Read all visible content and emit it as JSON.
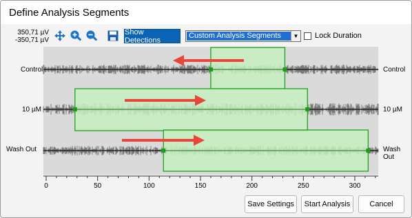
{
  "window": {
    "title": "Define Analysis Segments"
  },
  "toolbar": {
    "voltage_max": "350,71 µV",
    "voltage_min": "-350,71 µV",
    "show_detections_label": "Show Detections",
    "segments_select_value": "Custom Analysis Segments",
    "lock_duration_label": "Lock Duration",
    "lock_duration_checked": false,
    "icons": [
      "fit-axis-icon",
      "zoom-in-icon",
      "zoom-out-icon",
      "save-icon"
    ]
  },
  "channels": [
    {
      "label": "Control",
      "segment": [
        160,
        232
      ],
      "arrow": "left"
    },
    {
      "label": "10 µM",
      "segment": [
        28,
        254
      ],
      "arrow": "right"
    },
    {
      "label": "Wash Out",
      "segment": [
        114,
        313
      ],
      "arrow": "right"
    }
  ],
  "x_axis": {
    "ticks": [
      "0",
      "50",
      "100",
      "150",
      "200",
      "250",
      "300"
    ]
  },
  "buttons": {
    "save_settings": "Save Settings",
    "start_analysis": "Start Analysis",
    "cancel": "Cancel"
  },
  "colors": {
    "segment_fill": "#c6efc0",
    "segment_border": "#1ea01e",
    "arrow": "#e8463a",
    "accent": "#0a63b5"
  }
}
